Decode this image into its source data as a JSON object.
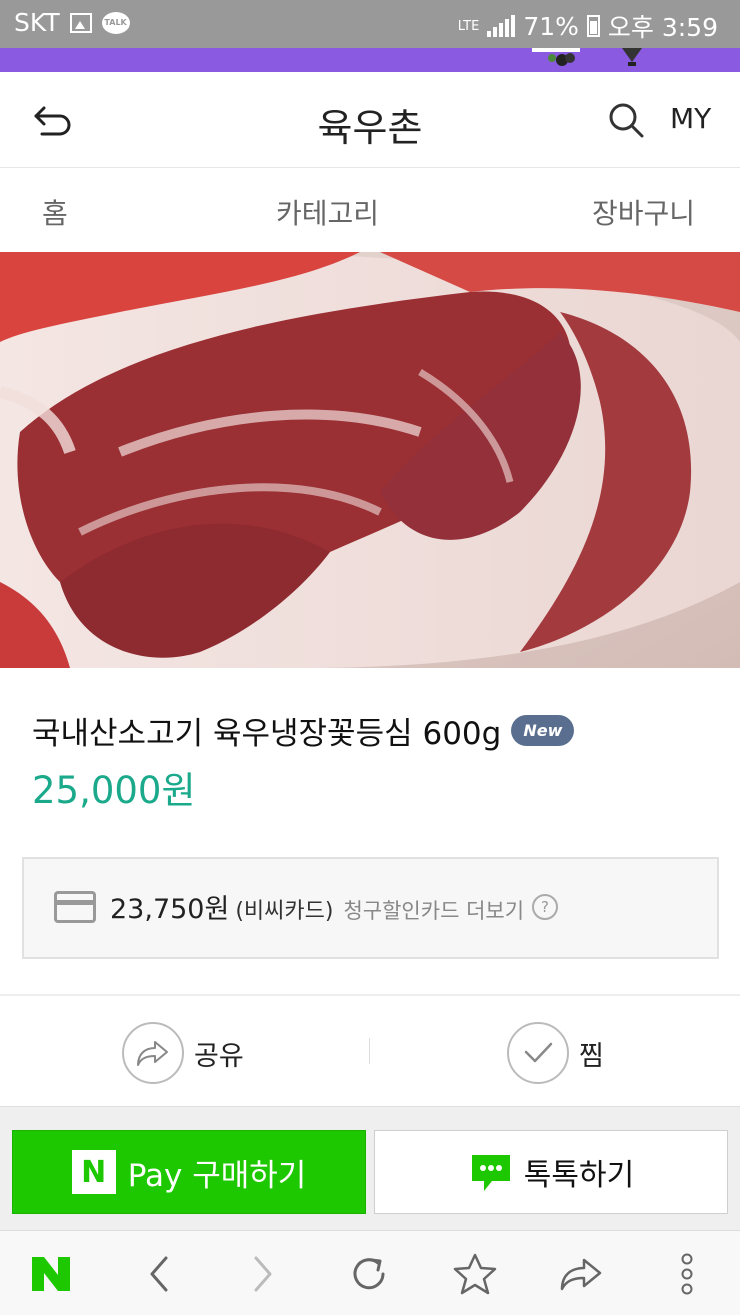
{
  "status_bar": {
    "carrier": "SKT",
    "talk_badge": "TALK",
    "network": "LTE",
    "battery": "71%",
    "time": "오후 3:59"
  },
  "header": {
    "title": "육우촌",
    "my_label": "MY",
    "icons": {
      "back": "back-arrow-icon",
      "search": "search-icon"
    }
  },
  "tabs": [
    {
      "label": "홈"
    },
    {
      "label": "카테고리"
    },
    {
      "label": "장바구니"
    }
  ],
  "product": {
    "name": "국내산소고기 육우냉장꽃등심 600g",
    "badge": "New",
    "price": "25,000원"
  },
  "card_discount": {
    "price": "23,750원",
    "card_name": "(비씨카드)",
    "more_link": "청구할인카드 더보기",
    "help": "?"
  },
  "actions": {
    "share_label": "공유",
    "like_label": "찜"
  },
  "buttons": {
    "npay_logo": "N",
    "npay_label": "Pay 구매하기",
    "talk_label": "톡톡하기"
  },
  "browser_bar": {
    "home_logo": "N",
    "icons": [
      "back-icon",
      "forward-icon",
      "refresh-icon",
      "bookmark-star-icon",
      "share-icon",
      "more-icon"
    ]
  },
  "colors": {
    "status_bar": "#999999",
    "banner": "#8a5ae0",
    "price": "#1aa98a",
    "npay_green": "#1ec800",
    "badge": "#5a6f8f"
  }
}
